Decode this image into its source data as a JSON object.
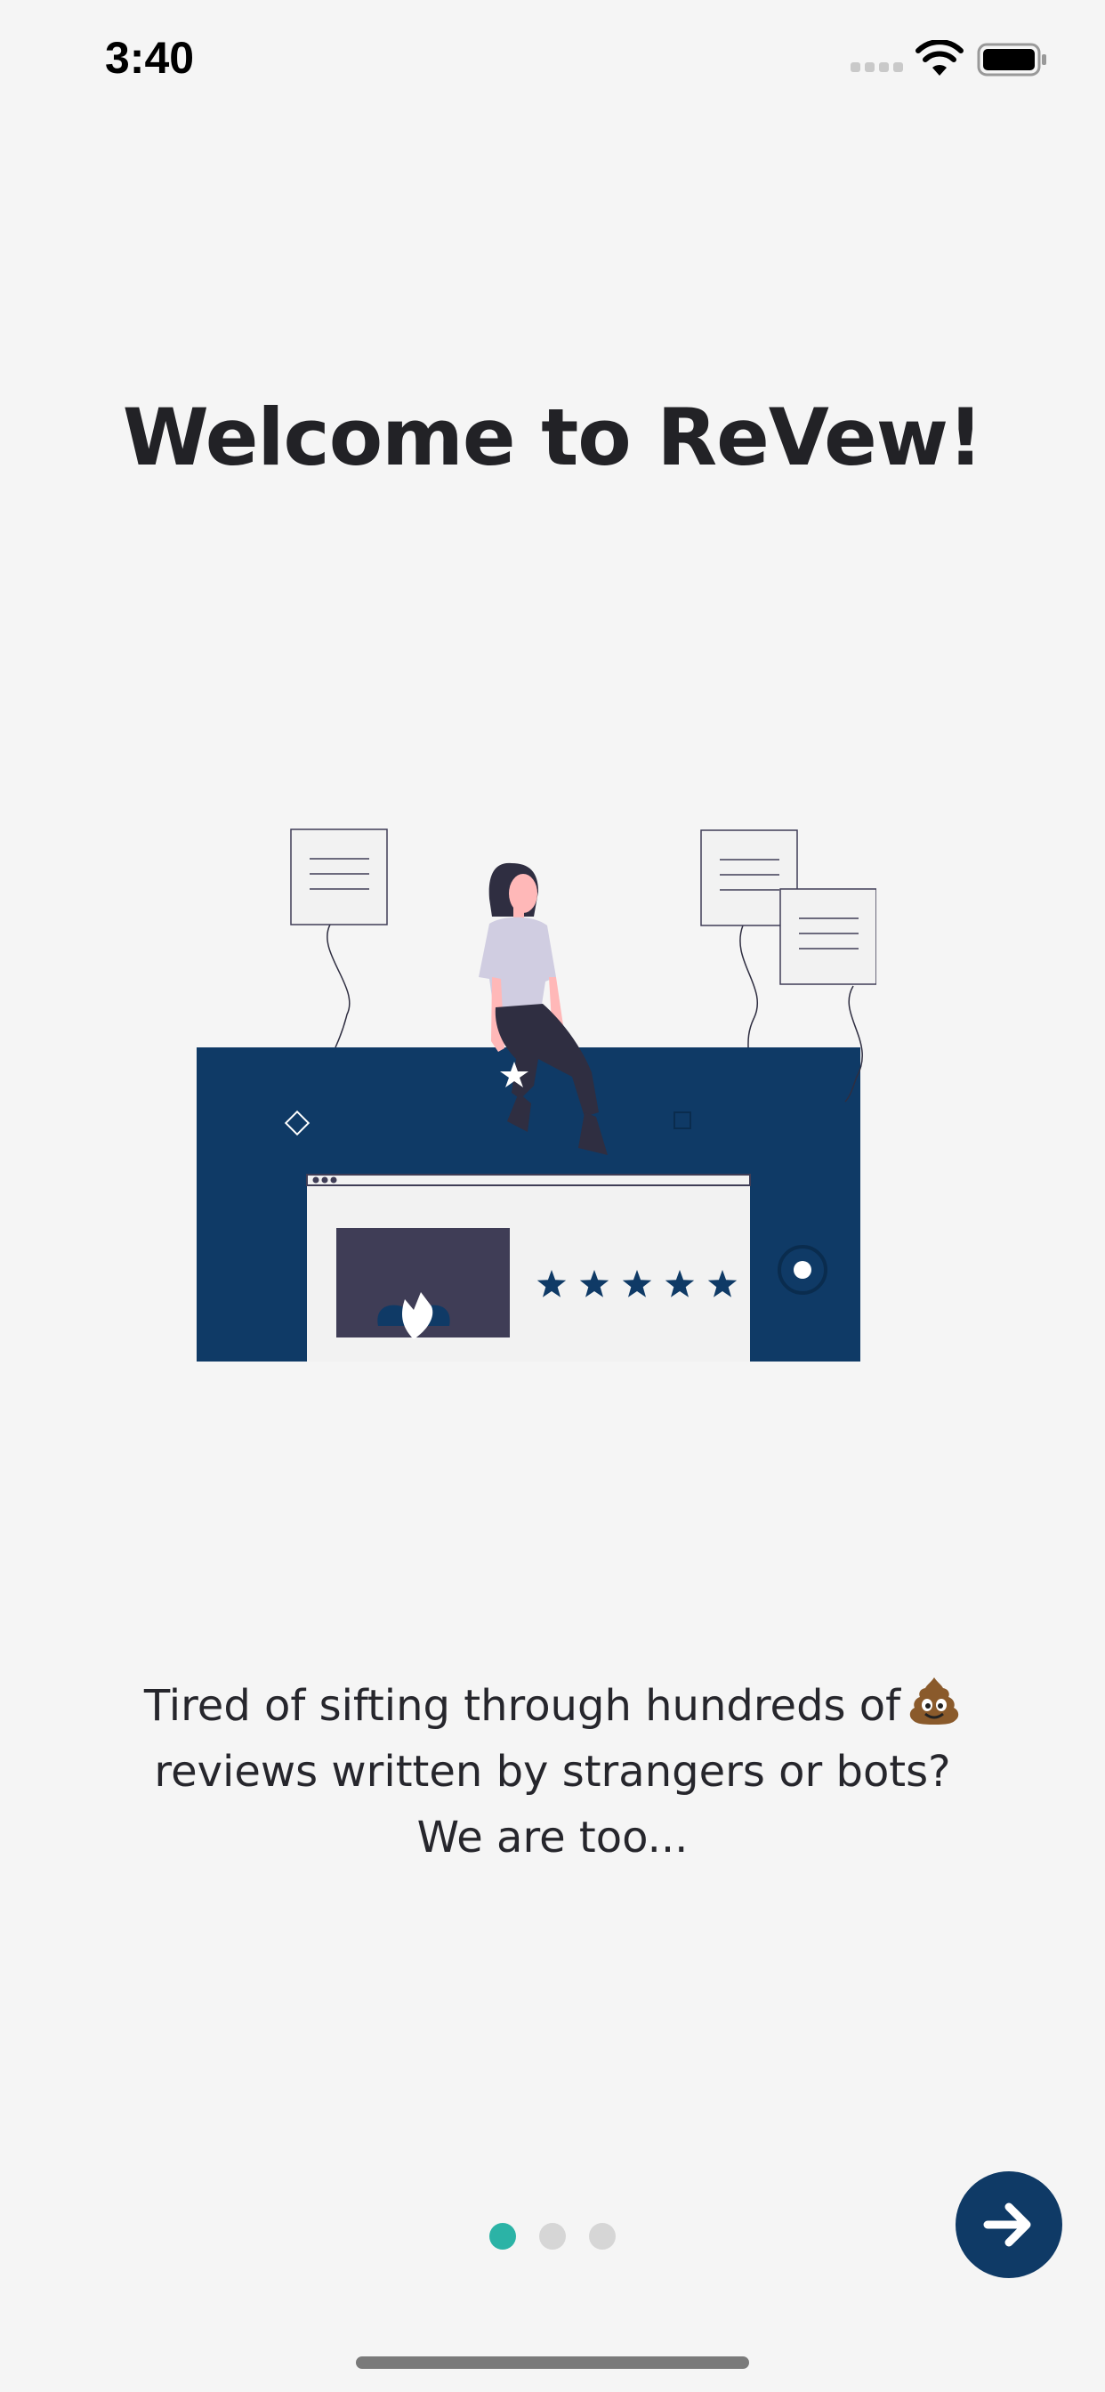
{
  "status_bar": {
    "time": "3:40"
  },
  "onboarding": {
    "title": "Welcome to ReVew!",
    "description_lines": [
      "Tired of sifting through hundreds of",
      "reviews written by strangers or bots?",
      "We are too..."
    ],
    "description_emoji": "poop-emoji",
    "illustration": "woman-sitting-on-review-board",
    "rating_stars": 5
  },
  "pagination": {
    "total_pages": 3,
    "current_page": 1
  },
  "next_button": {
    "icon": "arrow-right-icon"
  },
  "colors": {
    "background": "#f5f5f5",
    "primary_navy": "#0f3a66",
    "accent_teal": "#2bb3a6",
    "inactive_dot": "#d6d6d6",
    "text": "#222226"
  }
}
